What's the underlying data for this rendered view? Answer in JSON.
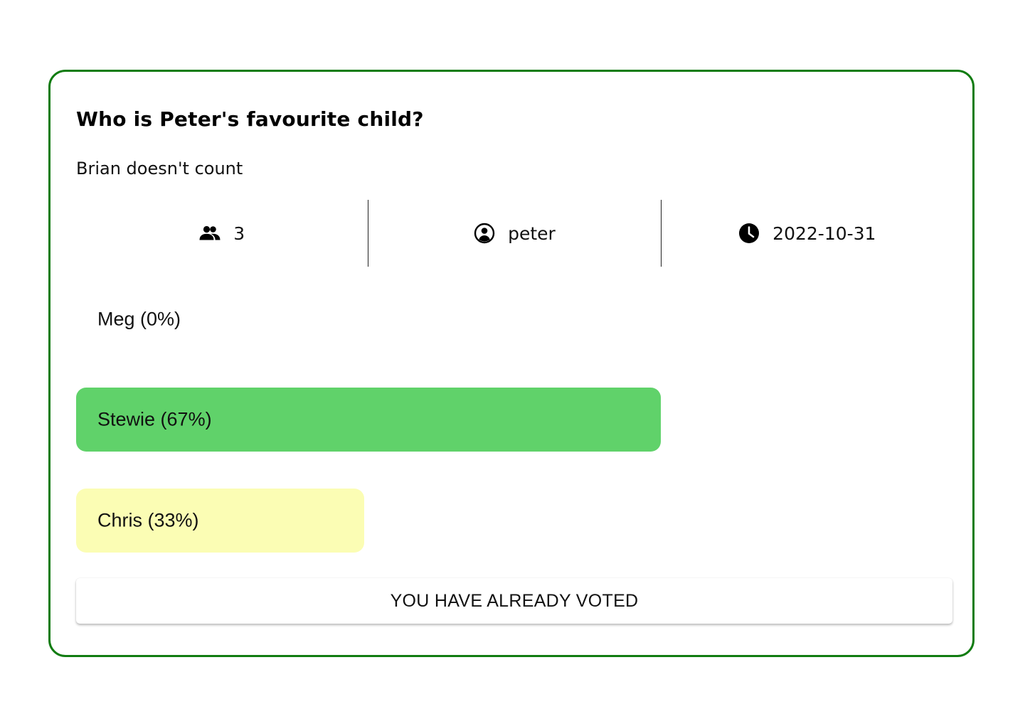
{
  "poll": {
    "title": "Who is Peter's favourite child?",
    "description": "Brian doesn't count",
    "meta": {
      "votes": "3",
      "author": "peter",
      "date": "2022-10-31"
    },
    "options": [
      {
        "label": "Meg (0%)",
        "percent": 0,
        "color": "#ffffff"
      },
      {
        "label": "Stewie (67%)",
        "percent": 67,
        "color": "#60d26a"
      },
      {
        "label": "Chris (33%)",
        "percent": 33,
        "color": "#fbfdb4"
      }
    ],
    "vote_button_label": "YOU HAVE ALREADY VOTED"
  },
  "colors": {
    "card_border": "#117c11",
    "winner_fill": "#60d26a",
    "runner_up_fill": "#fbfdb4"
  },
  "icons": {
    "votes": "group-icon",
    "author": "account-circle-icon",
    "date": "clock-icon"
  }
}
